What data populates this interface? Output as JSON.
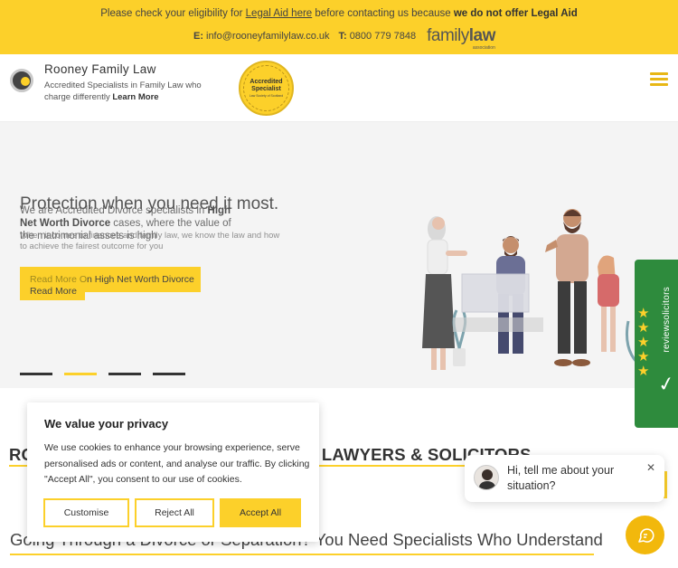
{
  "notice": {
    "prefix": "Please check your eligibility for ",
    "link": "Legal Aid here",
    "middle": " before contacting us because ",
    "emphasis": "we do not offer Legal Aid",
    "email_label": "E:",
    "email": "info@rooneyfamilylaw.co.uk",
    "phone_label": "T:",
    "phone": "0800 779 7848",
    "fla_logo_family": "family",
    "fla_logo_law": "law",
    "fla_logo_sub": "association"
  },
  "header": {
    "brand_name": "Rooney Family Law",
    "tagline": "Accredited Specialists in Family Law who charge differently ",
    "learn_more": "Learn More",
    "badge_line1": "Accredited",
    "badge_line2": "Specialist",
    "badge_line3": "Law Society of Scotland"
  },
  "hero": {
    "title": "Protection when you need it most.",
    "text_prefix": "We are Accredited Divorce specialists in ",
    "text_bold": "High Net Worth Divorce",
    "text_suffix": " cases, where the value of the matrimonial assets is high",
    "subtext": "When it comes to finances and family law, we know the law and how to achieve the fairest outcome for you",
    "button_ghost": "Read More O",
    "button_label": "n High Net Worth Divorce",
    "button2_label": "Read More",
    "slides": 4,
    "active_slide": 2
  },
  "review_widget": {
    "label": "reviewsolicitors",
    "stars": 5
  },
  "section": {
    "title_left": "RO",
    "title_right": "E LAWYERS & SOLICITORS",
    "heading": "Going Through a Divorce or Separation? You Need Specialists Who Understand"
  },
  "cookie": {
    "title": "We value your privacy",
    "body": "We use cookies to enhance your browsing experience, serve personalised ads or content, and analyse our traffic. By clicking \"Accept All\", you consent to our use of cookies.",
    "customise": "Customise",
    "reject": "Reject All",
    "accept": "Accept All"
  },
  "chat": {
    "message": "Hi, tell me about your situation?",
    "close": "✕"
  },
  "colors": {
    "brand_yellow": "#fcd02a",
    "review_green": "#2e8b3d"
  }
}
